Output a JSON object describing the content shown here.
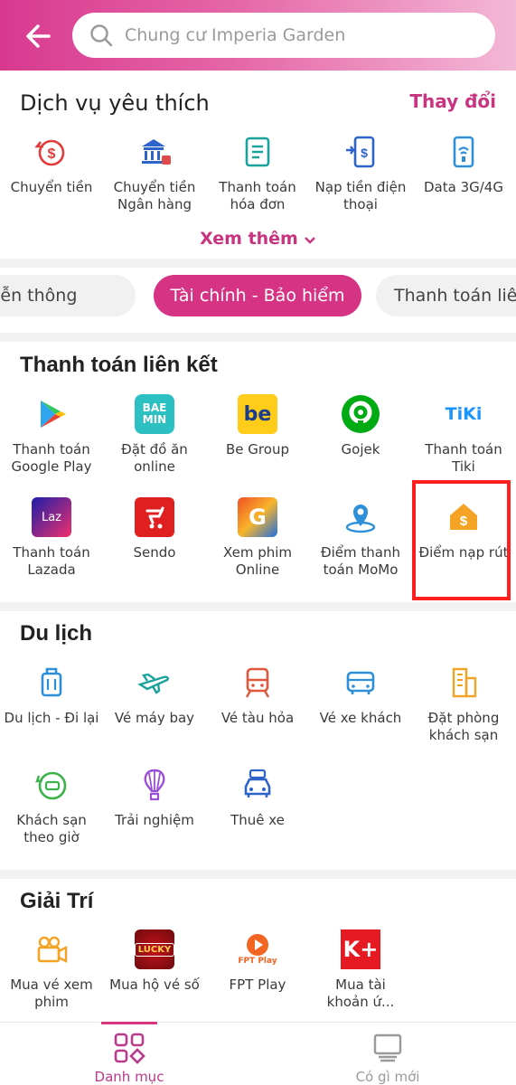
{
  "header": {
    "search_placeholder": "Chung cư Imperia Garden"
  },
  "favorites": {
    "title": "Dịch vụ yêu thích",
    "change_label": "Thay đổi",
    "more_label": "Xem thêm",
    "items": [
      {
        "label": "Chuyển tiền",
        "icon": "transfer-money-icon"
      },
      {
        "label": "Chuyển tiền Ngân hàng",
        "icon": "bank-transfer-icon"
      },
      {
        "label": "Thanh toán hóa đơn",
        "icon": "bill-icon"
      },
      {
        "label": "Nạp tiền điện thoại",
        "icon": "phone-topup-icon"
      },
      {
        "label": "Data 3G/4G",
        "icon": "data-icon"
      }
    ]
  },
  "tabs": [
    {
      "label": "Tiện ích viễn thông"
    },
    {
      "label": "Tài chính - Bảo hiểm"
    },
    {
      "label": "Thanh toán liên kết"
    }
  ],
  "linked": {
    "title": "Thanh toán liên kết",
    "items": [
      {
        "label": "Thanh toán Google Play",
        "icon": "google-play-icon"
      },
      {
        "label": "Đặt đồ ăn online",
        "icon": "baemin-icon",
        "badge": "BAE MIN"
      },
      {
        "label": "Be Group",
        "icon": "be-icon",
        "badge": "be"
      },
      {
        "label": "Gojek",
        "icon": "gojek-icon"
      },
      {
        "label": "Thanh toán Tiki",
        "icon": "tiki-icon",
        "badge": "TiKi"
      },
      {
        "label": "Thanh toán Lazada",
        "icon": "lazada-icon",
        "badge": "Laz"
      },
      {
        "label": "Sendo",
        "icon": "sendo-icon"
      },
      {
        "label": "Xem phim Online",
        "icon": "galaxy-play-icon",
        "badge": "G"
      },
      {
        "label": "Điểm thanh toán MoMo",
        "icon": "momo-location-icon"
      },
      {
        "label": "Điểm nạp rút",
        "icon": "cash-point-icon"
      }
    ]
  },
  "travel": {
    "title": "Du lịch",
    "items": [
      {
        "label": "Du lịch - Đi lại",
        "icon": "luggage-icon"
      },
      {
        "label": "Vé máy bay",
        "icon": "plane-icon"
      },
      {
        "label": "Vé tàu hỏa",
        "icon": "train-icon"
      },
      {
        "label": "Vé xe khách",
        "icon": "bus-icon"
      },
      {
        "label": "Đặt phòng khách sạn",
        "icon": "hotel-icon"
      },
      {
        "label": "Khách sạn theo giờ",
        "icon": "hourly-hotel-icon"
      },
      {
        "label": "Trải nghiệm",
        "icon": "balloon-icon"
      },
      {
        "label": "Thuê xe",
        "icon": "car-rental-icon"
      }
    ]
  },
  "entertainment": {
    "title": "Giải Trí",
    "items": [
      {
        "label": "Mua vé xem phim",
        "icon": "movie-camera-icon"
      },
      {
        "label": "Mua hộ vé số",
        "icon": "lottery-icon",
        "badge": "LUCKY"
      },
      {
        "label": "FPT Play",
        "icon": "fpt-play-icon",
        "badge": "FPT Play"
      },
      {
        "label": "Mua tài khoản ứ...",
        "icon": "kplus-icon",
        "badge": "K+"
      }
    ]
  },
  "bottom_nav": [
    {
      "label": "Danh mục",
      "icon": "category-icon"
    },
    {
      "label": "Có gì mới",
      "icon": "whats-new-icon"
    }
  ],
  "colors": {
    "brand": "#d63384",
    "highlight": "#ff1f1f"
  }
}
